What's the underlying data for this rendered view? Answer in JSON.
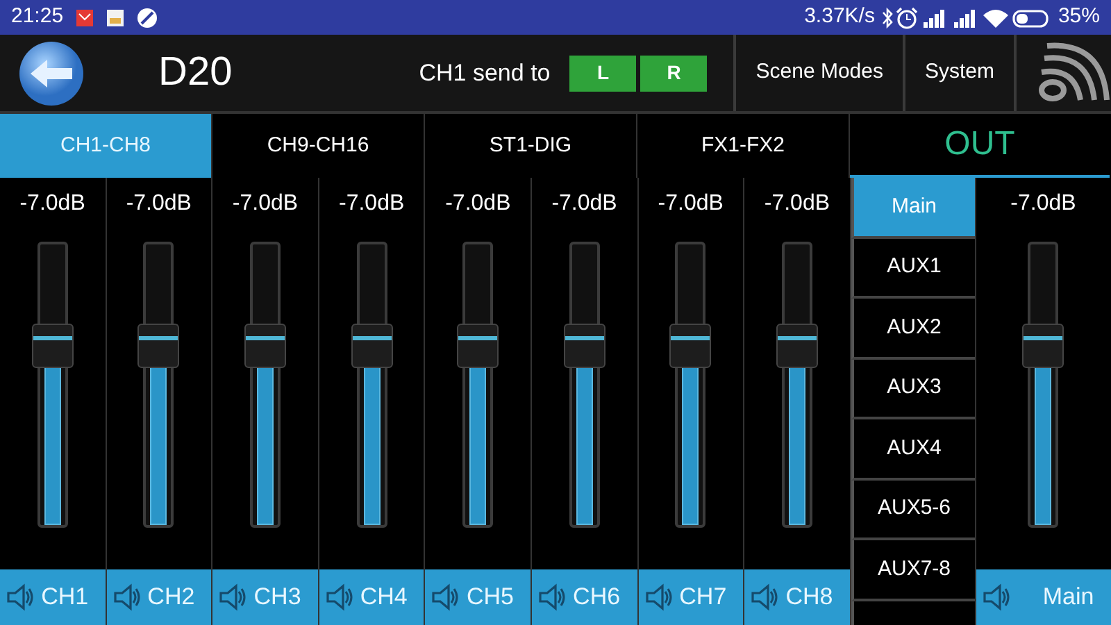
{
  "status_bar": {
    "time": "21:25",
    "net_speed": "3.37K/s",
    "battery": "35%"
  },
  "header": {
    "title": "D20",
    "send_label": "CH1  send to",
    "send_buttons": [
      {
        "label": "L",
        "on": true
      },
      {
        "label": "R",
        "on": true
      }
    ],
    "buttons": [
      "Scene Modes",
      "System"
    ]
  },
  "tabs": [
    {
      "label": "CH1-CH8",
      "selected": true
    },
    {
      "label": "CH9-CH16",
      "selected": false
    },
    {
      "label": "ST1-DIG",
      "selected": false
    },
    {
      "label": "FX1-FX2",
      "selected": false
    }
  ],
  "out_title": "OUT",
  "channels": [
    {
      "reading": "-7.0dB",
      "level": 0.63,
      "name": "CH1"
    },
    {
      "reading": "-7.0dB",
      "level": 0.63,
      "name": "CH2"
    },
    {
      "reading": "-7.0dB",
      "level": 0.63,
      "name": "CH3"
    },
    {
      "reading": "-7.0dB",
      "level": 0.63,
      "name": "CH4"
    },
    {
      "reading": "-7.0dB",
      "level": 0.63,
      "name": "CH5"
    },
    {
      "reading": "-7.0dB",
      "level": 0.63,
      "name": "CH6"
    },
    {
      "reading": "-7.0dB",
      "level": 0.63,
      "name": "CH7"
    },
    {
      "reading": "-7.0dB",
      "level": 0.63,
      "name": "CH8"
    }
  ],
  "out_list": [
    {
      "label": "Main",
      "selected": true
    },
    {
      "label": "AUX1",
      "selected": false
    },
    {
      "label": "AUX2",
      "selected": false
    },
    {
      "label": "AUX3",
      "selected": false
    },
    {
      "label": "AUX4",
      "selected": false
    },
    {
      "label": "AUX5-6",
      "selected": false
    },
    {
      "label": "AUX7-8",
      "selected": false
    }
  ],
  "master": {
    "reading": "-7.0dB",
    "level": 0.63,
    "name": "Main"
  }
}
